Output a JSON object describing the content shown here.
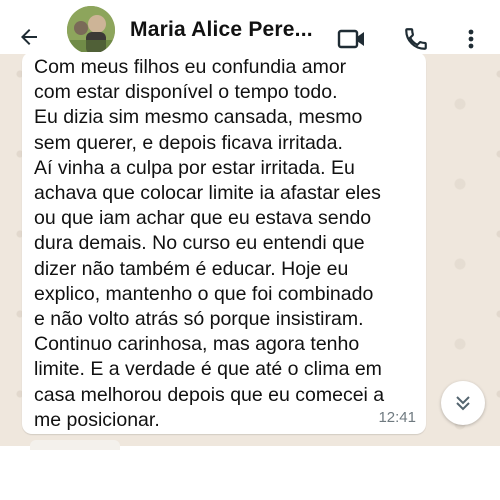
{
  "header": {
    "contact_name": "Maria Alice Pere...",
    "icons": {
      "back": "arrow-back-icon",
      "video": "video-call-icon",
      "call": "phone-icon",
      "menu": "more-vertical-icon"
    }
  },
  "message": {
    "text": "Com meus filhos eu confundia amor\ncom estar disponível o tempo todo.\nEu dizia sim mesmo cansada, mesmo\nsem querer, e depois ficava irritada.\nAí vinha a culpa por estar irritada. Eu\nachava que colocar limite ia afastar eles\nou que iam achar que eu estava sendo\ndura demais. No curso eu entendi que\ndizer não também é educar. Hoje eu\nexplico, mantenho o que foi combinado\ne não volto atrás só porque insistiram.\nContinuo carinhosa, mas agora tenho\nlimite. E a verdade é que até o clima em\ncasa melhorou depois que eu comecei a\nme posicionar.",
    "time": "12:41"
  },
  "colors": {
    "wallpaper": "#efe7dd",
    "bubble": "#ffffff",
    "time_text": "#6f7a80",
    "icon": "#1f2c34"
  }
}
